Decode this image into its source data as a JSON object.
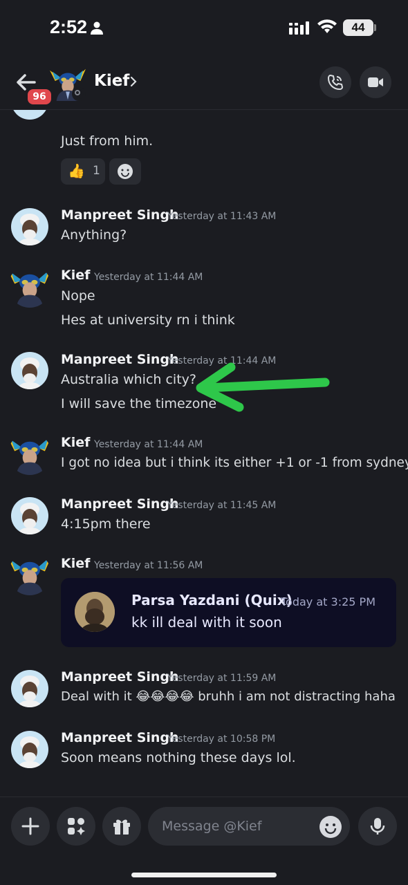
{
  "status_bar": {
    "time": "2:52",
    "battery": "44"
  },
  "header": {
    "back_badge": "96",
    "title": "Kief",
    "chevron": "›"
  },
  "messages": [
    {
      "id": "m0",
      "text": "Just from him.",
      "reactions": [
        {
          "emoji": "👍",
          "count": "1"
        }
      ]
    },
    {
      "id": "m1",
      "author": "Manpreet Singh",
      "timestamp": "Yesterday at 11:43 AM",
      "lines": [
        "Anything?"
      ]
    },
    {
      "id": "m2",
      "author": "Kief",
      "timestamp": "Yesterday at 11:44 AM",
      "lines": [
        "Nope",
        "Hes at university rn i think"
      ]
    },
    {
      "id": "m3",
      "author": "Manpreet Singh",
      "timestamp": "Yesterday at 11:44 AM",
      "lines": [
        "Australia which city?",
        "I will save the timezone"
      ]
    },
    {
      "id": "m4",
      "author": "Kief",
      "timestamp": "Yesterday at 11:44 AM",
      "lines": [
        "I got no idea but i think its either +1 or -1 from sydney"
      ]
    },
    {
      "id": "m5",
      "author": "Manpreet Singh",
      "timestamp": "Yesterday at 11:45 AM",
      "lines": [
        "4:15pm there"
      ]
    },
    {
      "id": "m6",
      "author": "Kief",
      "timestamp": "Yesterday at 11:56 AM",
      "forward": {
        "author": "Parsa Yazdani (Quix)",
        "timestamp": "Today at 3:25 PM",
        "text": "kk ill deal with it soon"
      }
    },
    {
      "id": "m7",
      "author": "Manpreet Singh",
      "timestamp": "Yesterday at 11:59 AM",
      "lines": [
        "Deal with it 😂😂😂😂 bruhh i am not distracting haha"
      ]
    },
    {
      "id": "m8",
      "author": "Manpreet Singh",
      "timestamp": "Yesterday at 10:58 PM",
      "lines": [
        "Soon means nothing these days lol."
      ]
    }
  ],
  "composer": {
    "placeholder": "Message @Kief"
  },
  "colors": {
    "background": "#1b1c21",
    "badge": "#e0474c",
    "arrow": "#2ec74a",
    "reply_card": "#0e0e24"
  }
}
